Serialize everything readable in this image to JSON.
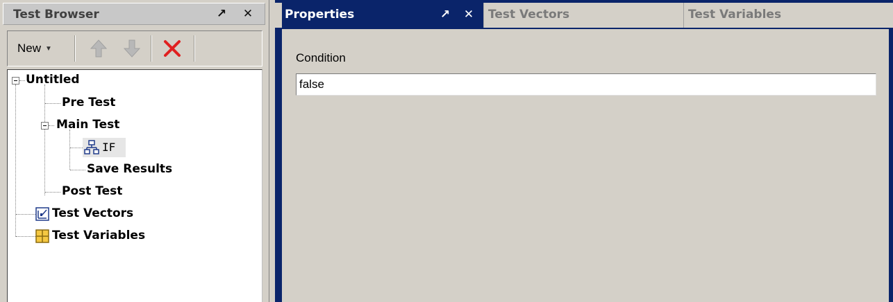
{
  "test_browser": {
    "title": "Test Browser",
    "float_glyph": "↗",
    "close_glyph": "✕",
    "toolbar": {
      "new_label": "New",
      "new_caret": "▼",
      "icons": [
        "arrow-up-icon",
        "arrow-down-icon",
        "delete-icon"
      ]
    },
    "tree": {
      "root": "Untitled",
      "pre_test": "Pre Test",
      "main_test": "Main Test",
      "if_node": "IF",
      "save_results": "Save Results",
      "post_test": "Post Test",
      "test_vectors": "Test Vectors",
      "test_variables": "Test Variables"
    }
  },
  "properties": {
    "tabs": [
      {
        "label": "Properties",
        "active": true
      },
      {
        "label": "Test Vectors",
        "active": false
      },
      {
        "label": "Test Variables",
        "active": false
      }
    ],
    "float_glyph": "↗",
    "close_glyph": "✕",
    "condition_label": "Condition",
    "condition_value": "false"
  },
  "colors": {
    "active_tab": "#0a246a",
    "inactive_tab_text": "#7a7a7a",
    "panel_bg": "#d4d0c8",
    "delete_red": "#e02020"
  }
}
